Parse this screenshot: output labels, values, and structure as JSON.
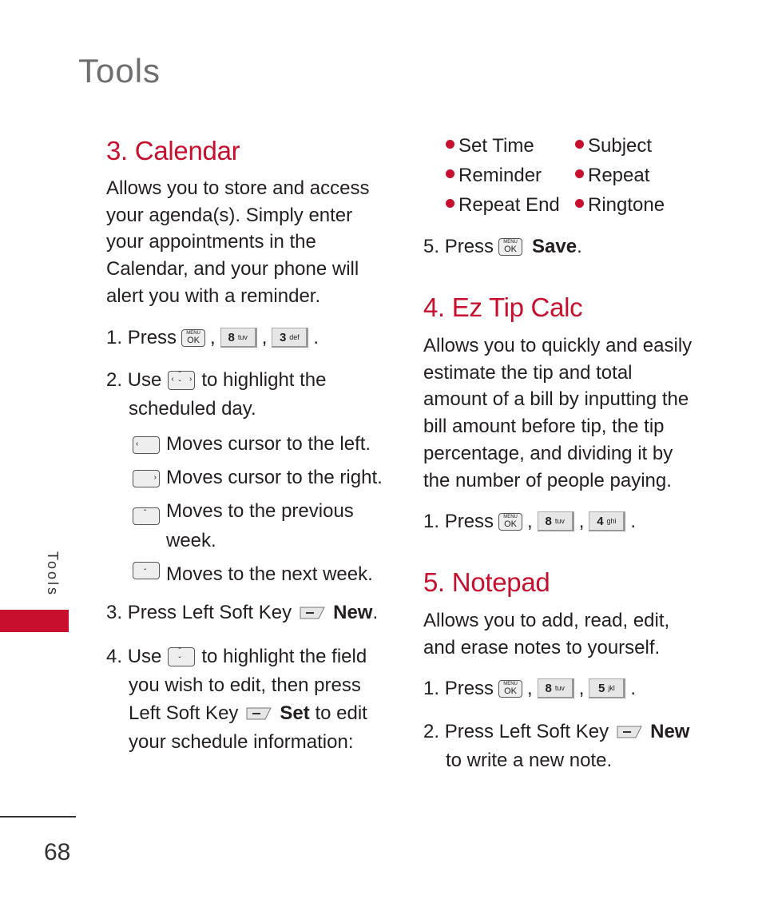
{
  "page": {
    "title": "Tools",
    "side_tab_label": "Tools",
    "page_number": "68",
    "accent_color": "#c8102e"
  },
  "calendar": {
    "heading": "3. Calendar",
    "intro_lines": [
      "Allows you to store and access",
      "your agenda(s). Simply enter",
      "your appointments in the",
      "Calendar, and your phone will",
      "alert you with a reminder."
    ],
    "step1": {
      "num": "1.",
      "text": "Press",
      "keys": [
        {
          "type": "menu-ok",
          "top": "MENU",
          "bottom": "OK"
        },
        {
          "type": "num",
          "digit": "8",
          "letters": "tuv"
        },
        {
          "type": "num",
          "digit": "3",
          "letters": "def"
        }
      ]
    },
    "step2": {
      "num": "2.",
      "pre": "Use",
      "post": "to highlight the",
      "cont": "scheduled day."
    },
    "nav_items": [
      {
        "icon": "nav-left-key-icon",
        "text": "Moves cursor to the left."
      },
      {
        "icon": "nav-right-key-icon",
        "text": "Moves cursor to the right."
      },
      {
        "icon": "nav-up-key-icon",
        "text": "Moves to the previous",
        "cont": "week."
      },
      {
        "icon": "nav-down-key-icon",
        "text": "Moves to the next week."
      }
    ],
    "step3": {
      "num": "3.",
      "text": "Press Left Soft Key",
      "action": "New",
      "end": "."
    },
    "step4": {
      "num": "4.",
      "pre": "Use",
      "post": "to highlight the field",
      "line2": "you wish to edit, then press",
      "line3_pre": "Left Soft Key",
      "action": "Set",
      "line3_post": "to edit",
      "line4": "your schedule information:"
    },
    "fields": [
      "Set Time",
      "Subject",
      "Reminder",
      "Repeat",
      "Repeat End",
      "Ringtone"
    ],
    "step5": {
      "num": "5.",
      "text": "Press",
      "action": "Save",
      "end": "."
    }
  },
  "ez_tip_calc": {
    "heading": "4. Ez Tip Calc",
    "intro_lines": [
      "Allows you to quickly and easily",
      "estimate the tip and total",
      "amount of a bill by inputting the",
      "bill amount before tip, the tip",
      "percentage, and dividing it by",
      "the number of people paying."
    ],
    "step1": {
      "num": "1.",
      "text": "Press",
      "keys": [
        {
          "top": "MENU",
          "bottom": "OK"
        },
        {
          "digit": "8",
          "letters": "tuv"
        },
        {
          "digit": "4",
          "letters": "ghi"
        }
      ]
    }
  },
  "notepad": {
    "heading": "5. Notepad",
    "intro_lines": [
      "Allows you to add, read, edit,",
      "and erase notes to yourself."
    ],
    "step1": {
      "num": "1.",
      "text": "Press",
      "keys": [
        {
          "top": "MENU",
          "bottom": "OK"
        },
        {
          "digit": "8",
          "letters": "tuv"
        },
        {
          "digit": "5",
          "letters": "jkl"
        }
      ]
    },
    "step2": {
      "num": "2.",
      "text": "Press Left Soft Key",
      "action": "New",
      "cont": "to write a new note."
    }
  }
}
